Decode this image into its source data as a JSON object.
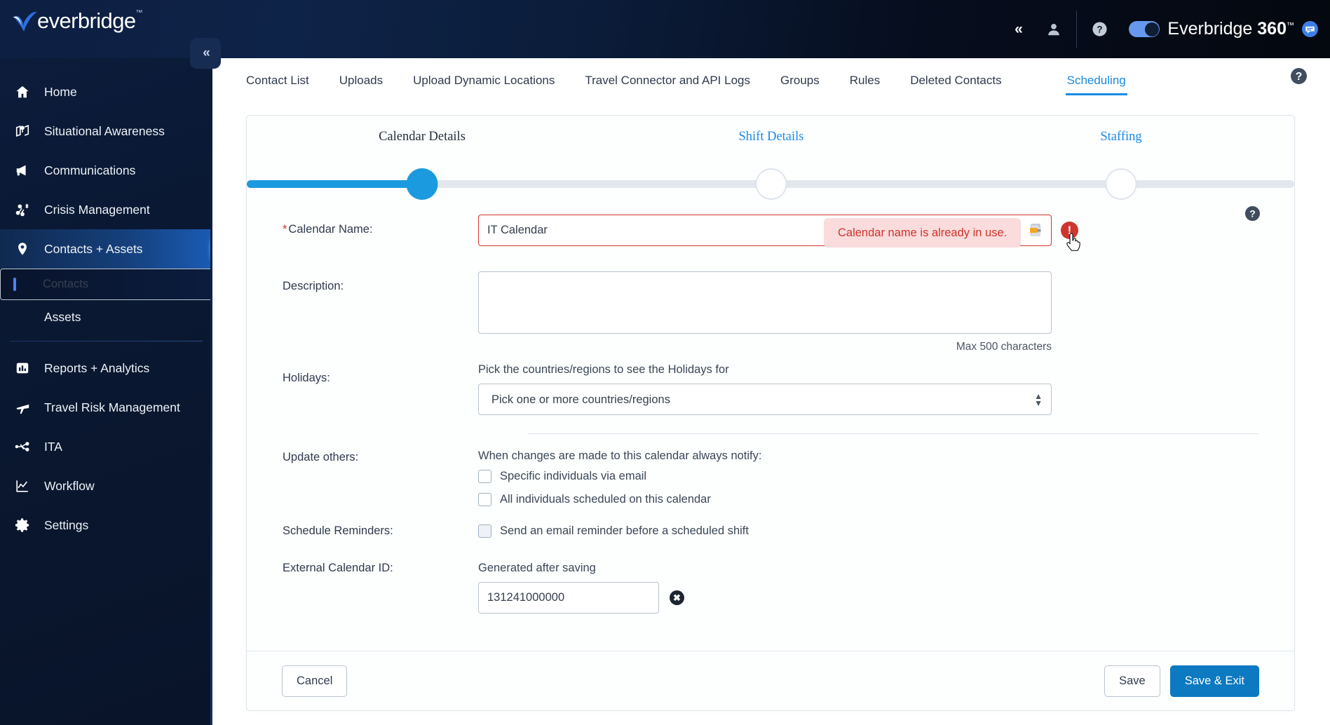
{
  "header": {
    "logo_text": "everbridge",
    "logo_tm": "™",
    "collapse_nav_icon": "chevron-double-left-icon",
    "user_icon": "user-icon",
    "help_icon": "help-circle-icon",
    "brand_prefix": "Everbridge ",
    "brand_number": "360",
    "brand_tm": "™",
    "chat_icon": "chat-bubble-icon",
    "toggle_on": true
  },
  "sidebar": {
    "collapse_label": "«",
    "items": [
      {
        "label": "Home",
        "icon": "home-icon",
        "active": false
      },
      {
        "label": "Situational Awareness",
        "icon": "map-pin-icon",
        "active": false
      },
      {
        "label": "Communications",
        "icon": "megaphone-icon",
        "active": false
      },
      {
        "label": "Crisis Management",
        "icon": "network-nodes-icon",
        "active": false
      },
      {
        "label": "Contacts + Assets",
        "icon": "location-pin-icon",
        "active": true
      }
    ],
    "sub_items": [
      {
        "label": "Contacts",
        "selected": true
      },
      {
        "label": "Assets",
        "selected": false
      }
    ],
    "items_bottom": [
      {
        "label": "Reports + Analytics",
        "icon": "bar-chart-icon"
      },
      {
        "label": "Travel Risk Management",
        "icon": "airplane-icon"
      },
      {
        "label": "ITA",
        "icon": "ita-nodes-icon"
      },
      {
        "label": "Workflow",
        "icon": "line-chart-icon"
      },
      {
        "label": "Settings",
        "icon": "gear-icon"
      }
    ]
  },
  "tabs": [
    {
      "label": "Contact List",
      "active": false
    },
    {
      "label": "Uploads",
      "active": false
    },
    {
      "label": "Upload Dynamic Locations",
      "active": false
    },
    {
      "label": "Travel Connector and API Logs",
      "active": false
    },
    {
      "label": "Groups",
      "active": false
    },
    {
      "label": "Rules",
      "active": false
    },
    {
      "label": "Deleted Contacts",
      "active": false
    },
    {
      "label": "Scheduling",
      "active": true
    }
  ],
  "tab_help_icon": "help-circle-icon",
  "stepper": {
    "steps": [
      {
        "label": "Calendar Details",
        "state": "current"
      },
      {
        "label": "Shift Details",
        "state": "todo"
      },
      {
        "label": "Staffing",
        "state": "todo"
      }
    ],
    "progress_percent": 17
  },
  "panel_help_icon": "help-circle-icon",
  "form": {
    "calendar_name": {
      "label": "Calendar Name:",
      "required_mark": "*",
      "value": "IT Calendar",
      "placeholder": "",
      "error_message": "Calendar name is already in use.",
      "error_badge": "!"
    },
    "description": {
      "label": "Description:",
      "value": "",
      "placeholder": "",
      "max_hint": "Max 500 characters"
    },
    "holidays": {
      "label": "Holidays:",
      "helper": "Pick the countries/regions to see the Holidays for",
      "selected": "Pick one or more countries/regions",
      "options": [
        "Pick one or more countries/regions"
      ]
    },
    "update_others": {
      "label": "Update others:",
      "helper": "When changes are made to this calendar always notify:",
      "checkboxes": [
        {
          "label": "Specific individuals via email",
          "checked": false
        },
        {
          "label": "All individuals scheduled on this calendar",
          "checked": false
        }
      ]
    },
    "schedule_reminders": {
      "label": "Schedule Reminders:",
      "checkboxes": [
        {
          "label": "Send an email reminder before a scheduled shift",
          "checked": false
        }
      ]
    },
    "external_calendar_id": {
      "label": "External Calendar ID:",
      "helper": "Generated after saving",
      "value": "131241000000",
      "clear_icon": "clear-circle-x-icon"
    }
  },
  "footer": {
    "cancel_label": "Cancel",
    "save_label": "Save",
    "save_exit_label": "Save & Exit"
  },
  "colors": {
    "accent_blue": "#1a8ae5",
    "primary_button": "#0c79c0",
    "error_red": "#d0342c",
    "error_bg": "#fadcdc",
    "sidebar_dark": "#0a1833",
    "step_done": "#1b9ae0"
  }
}
